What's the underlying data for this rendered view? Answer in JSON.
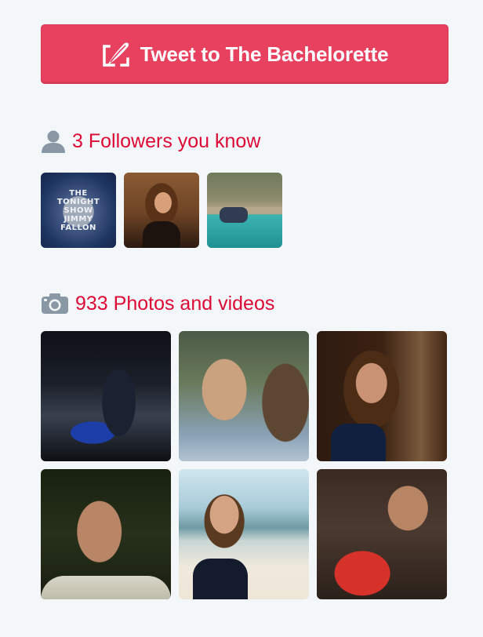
{
  "tweet_button": {
    "label": "Tweet to The Bachelorette",
    "icon": "quill-icon",
    "color": "#e8405f"
  },
  "followers_section": {
    "title": "3 Followers you know",
    "icon": "person-icon",
    "title_color": "#dd0a36",
    "avatars": [
      {
        "name": "The Tonight Show Starring Jimmy Fallon",
        "logo_text": "THE TONIGHT SHOW JIMMY FALLON"
      },
      {
        "name": "follower-2"
      },
      {
        "name": "follower-3"
      }
    ]
  },
  "photos_section": {
    "title": "933 Photos and videos",
    "icon": "camera-icon",
    "count": 933,
    "thumbnails": 6
  }
}
